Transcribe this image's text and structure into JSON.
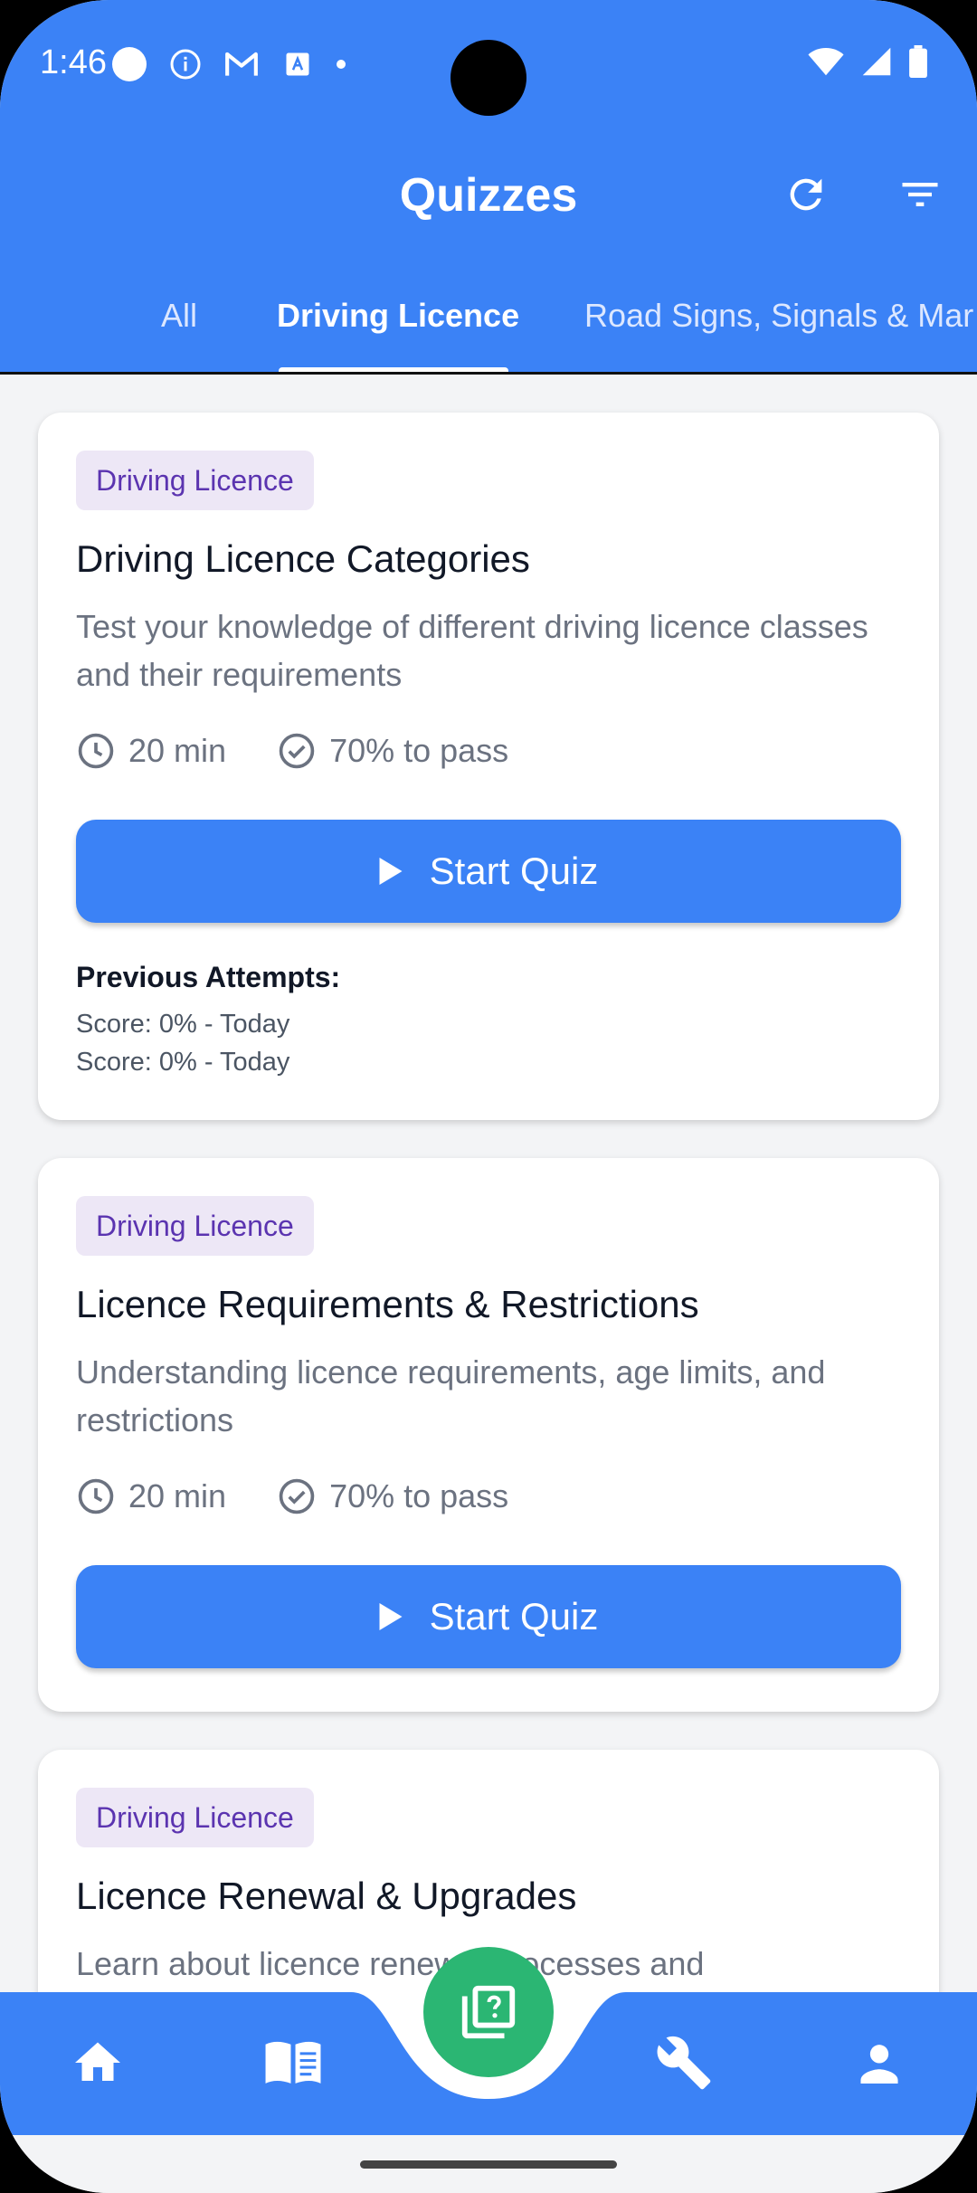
{
  "status_bar": {
    "time": "1:46"
  },
  "header": {
    "title": "Quizzes",
    "tabs": [
      {
        "label": "All"
      },
      {
        "label": "Driving Licence"
      },
      {
        "label": "Road Signs, Signals & Mar"
      }
    ],
    "active_tab": "Driving Licence"
  },
  "cards": [
    {
      "badge": "Driving Licence",
      "title": "Driving Licence Categories",
      "description": "Test your knowledge of different driving licence classes and their requirements",
      "duration": "20 min",
      "pass": "70% to pass",
      "button": "Start Quiz",
      "previous_title": "Previous Attempts:",
      "previous": [
        "Score: 0% - Today",
        "Score: 0% - Today"
      ]
    },
    {
      "badge": "Driving Licence",
      "title": "Licence Requirements & Restrictions",
      "description": "Understanding licence requirements, age limits, and restrictions",
      "duration": "20 min",
      "pass": "70% to pass",
      "button": "Start Quiz"
    },
    {
      "badge": "Driving Licence",
      "title": "Licence Renewal & Upgrades",
      "description": "Learn about licence renewal processes and"
    }
  ],
  "bottom_nav": {
    "items": [
      {
        "icon": "home-icon"
      },
      {
        "icon": "book-icon"
      },
      {
        "icon": "quiz-icon"
      },
      {
        "icon": "wrench-icon"
      },
      {
        "icon": "person-icon"
      }
    ]
  },
  "colors": {
    "primary": "#3B82F6",
    "fab": "#2BB673",
    "badge_bg": "#EDE7F6",
    "badge_text": "#5B34B0",
    "background": "#F3F4F6"
  }
}
